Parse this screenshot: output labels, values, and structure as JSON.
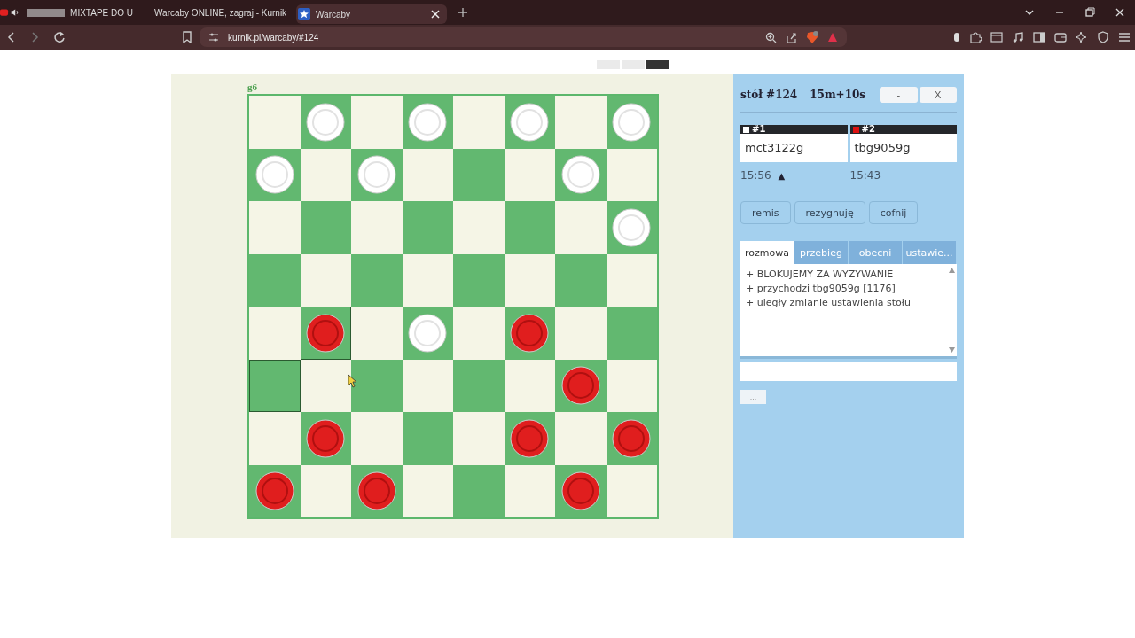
{
  "browser": {
    "tabs": [
      {
        "title": "MIXTAPE DO U",
        "kind": "media",
        "selected": false
      },
      {
        "title": "Warcaby ONLINE, zagraj - Kurnik",
        "kind": "site",
        "selected": false
      },
      {
        "title": "Warcaby",
        "kind": "site",
        "selected": true
      }
    ],
    "url": "kurnik.pl/warcaby/#124"
  },
  "board": {
    "coordinate": "g6",
    "rows": [
      [
        {
          "kind": "empty",
          "highlighted": false
        },
        {
          "kind": "white",
          "highlighted": false
        },
        {
          "kind": "empty",
          "highlighted": false
        },
        {
          "kind": "white",
          "highlighted": false
        },
        {
          "kind": "empty",
          "highlighted": false
        },
        {
          "kind": "white",
          "highlighted": false
        },
        {
          "kind": "empty",
          "highlighted": false
        },
        {
          "kind": "white",
          "highlighted": false
        }
      ],
      [
        {
          "kind": "white",
          "highlighted": false
        },
        {
          "kind": "empty",
          "highlighted": false
        },
        {
          "kind": "white",
          "highlighted": false
        },
        {
          "kind": "empty",
          "highlighted": false
        },
        {
          "kind": "empty",
          "highlighted": false
        },
        {
          "kind": "empty",
          "highlighted": false
        },
        {
          "kind": "white",
          "highlighted": false
        },
        {
          "kind": "empty",
          "highlighted": false
        }
      ],
      [
        {
          "kind": "empty",
          "highlighted": false
        },
        {
          "kind": "empty",
          "highlighted": false
        },
        {
          "kind": "empty",
          "highlighted": false
        },
        {
          "kind": "empty",
          "highlighted": false
        },
        {
          "kind": "empty",
          "highlighted": false
        },
        {
          "kind": "empty",
          "highlighted": false
        },
        {
          "kind": "empty",
          "highlighted": false
        },
        {
          "kind": "white",
          "highlighted": false
        }
      ],
      [
        {
          "kind": "empty",
          "highlighted": false
        },
        {
          "kind": "empty",
          "highlighted": false
        },
        {
          "kind": "empty",
          "highlighted": false
        },
        {
          "kind": "empty",
          "highlighted": false
        },
        {
          "kind": "empty",
          "highlighted": false
        },
        {
          "kind": "empty",
          "highlighted": false
        },
        {
          "kind": "empty",
          "highlighted": false
        },
        {
          "kind": "empty",
          "highlighted": false
        }
      ],
      [
        {
          "kind": "empty",
          "highlighted": false
        },
        {
          "kind": "red",
          "highlighted": true
        },
        {
          "kind": "empty",
          "highlighted": false
        },
        {
          "kind": "white",
          "highlighted": false
        },
        {
          "kind": "empty",
          "highlighted": false
        },
        {
          "kind": "red",
          "highlighted": false
        },
        {
          "kind": "empty",
          "highlighted": false
        },
        {
          "kind": "empty",
          "highlighted": false
        }
      ],
      [
        {
          "kind": "empty",
          "highlighted": true
        },
        {
          "kind": "empty",
          "highlighted": false
        },
        {
          "kind": "empty",
          "highlighted": false
        },
        {
          "kind": "empty",
          "highlighted": false
        },
        {
          "kind": "empty",
          "highlighted": false
        },
        {
          "kind": "empty",
          "highlighted": false
        },
        {
          "kind": "red",
          "highlighted": false
        },
        {
          "kind": "empty",
          "highlighted": false
        }
      ],
      [
        {
          "kind": "empty",
          "highlighted": false
        },
        {
          "kind": "red",
          "highlighted": false
        },
        {
          "kind": "empty",
          "highlighted": false
        },
        {
          "kind": "empty",
          "highlighted": false
        },
        {
          "kind": "empty",
          "highlighted": false
        },
        {
          "kind": "red",
          "highlighted": false
        },
        {
          "kind": "empty",
          "highlighted": false
        },
        {
          "kind": "red",
          "highlighted": false
        }
      ],
      [
        {
          "kind": "red",
          "highlighted": false
        },
        {
          "kind": "empty",
          "highlighted": false
        },
        {
          "kind": "red",
          "highlighted": false
        },
        {
          "kind": "empty",
          "highlighted": false
        },
        {
          "kind": "empty",
          "highlighted": false
        },
        {
          "kind": "empty",
          "highlighted": false
        },
        {
          "kind": "red",
          "highlighted": false
        },
        {
          "kind": "empty",
          "highlighted": false
        }
      ]
    ]
  },
  "panel": {
    "table": "stół #124",
    "time_control": "15m+10s",
    "window_buttons": [
      "-",
      "X"
    ],
    "players": [
      {
        "seat": "#1",
        "color": "#ffffff",
        "name": "mct3122g",
        "clock": "15:56",
        "turn": true
      },
      {
        "seat": "#2",
        "color": "#dd1111",
        "name": "tbg9059g",
        "clock": "15:43",
        "turn": false
      }
    ],
    "turn_marker": "▲",
    "actions": [
      "remis",
      "rezygnuję",
      "cofnij"
    ],
    "tabs": [
      {
        "label": "rozmowa",
        "selected": true
      },
      {
        "label": "przebieg",
        "selected": false
      },
      {
        "label": "obecni",
        "selected": false
      },
      {
        "label": "ustawie...",
        "selected": false
      }
    ],
    "chat": [
      "+ BLOKUJEMY ZA WYZYWANIE",
      "+ przychodzi tbg9059g [1176]",
      "+ uległy zmianie ustawienia stołu"
    ],
    "more_button": "..."
  }
}
